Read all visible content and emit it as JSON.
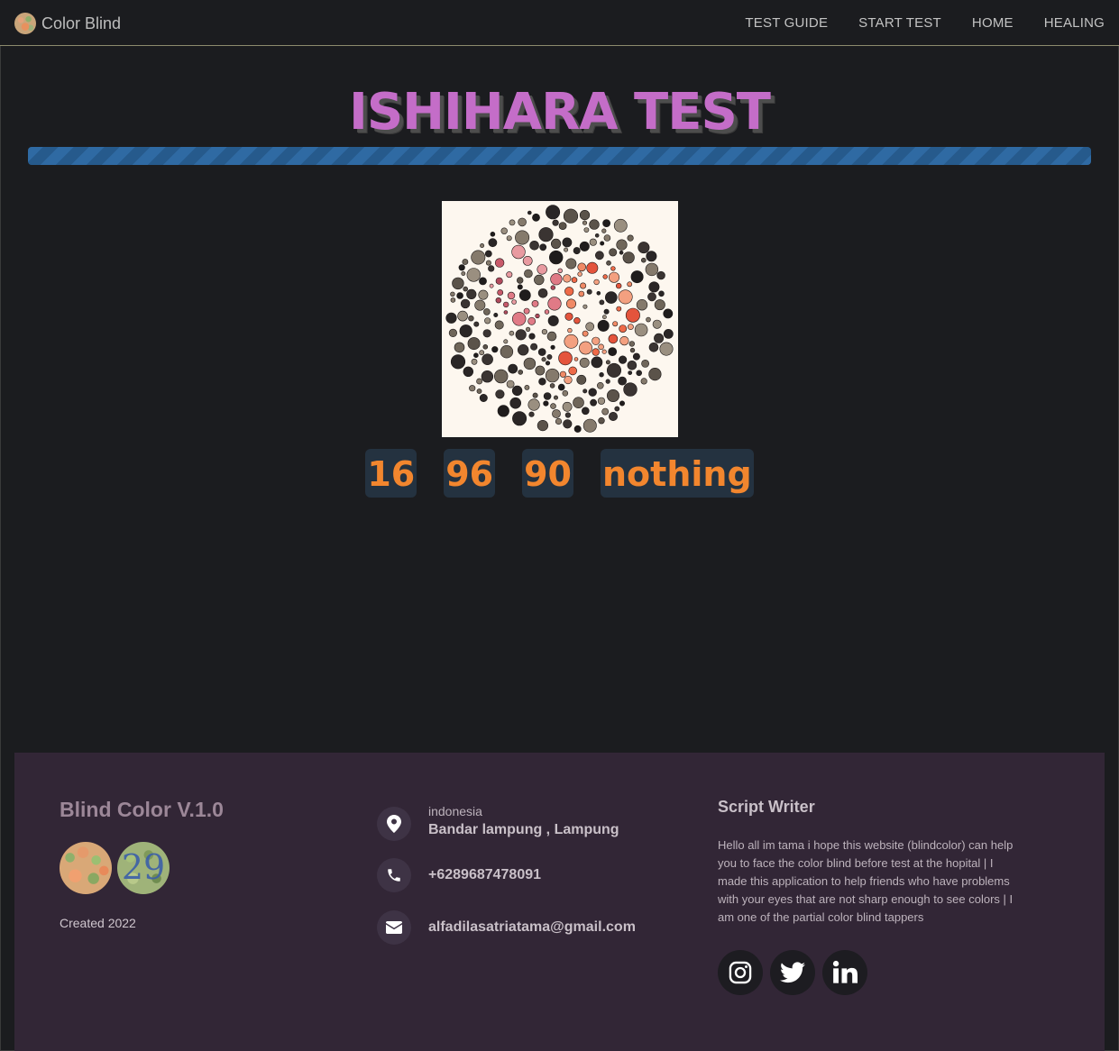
{
  "navbar": {
    "brand": "Color Blind",
    "links": [
      "TEST GUIDE",
      "START TEST",
      "HOME",
      "HEALING"
    ]
  },
  "main": {
    "title": "ISHIHARA TEST",
    "progress_fraction": 1.0,
    "answers": [
      "16",
      "96",
      "90",
      "nothing"
    ]
  },
  "footer": {
    "title": "Blind Color V.1.0",
    "logo_b_number": "29",
    "created": "Created 2022",
    "contact": {
      "country": "indonesia",
      "city": "Bandar lampung , Lampung",
      "phone": "+6289687478091",
      "email": "alfadilasatriatama@gmail.com"
    },
    "writer_title": "Script Writer",
    "writer_desc": "Hello all im tama i hope this website (blindcolor) can help you to face the color blind before test at the hopital | I made this application to help friends who have problems with your eyes that are not sharp enough to see colors | I am one of the partial color blind tappers",
    "socials": [
      "instagram-icon",
      "twitter-icon",
      "linkedin-icon"
    ]
  },
  "colors": {
    "background": "#1b1c1f",
    "title": "#c46dc8",
    "answer_text": "#f2862e",
    "footer_bg": "#322636",
    "progress": "#2f6aa3"
  }
}
